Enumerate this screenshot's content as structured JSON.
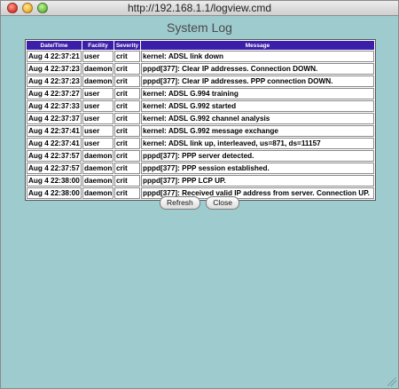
{
  "window": {
    "title": "http://192.168.1.1/logview.cmd"
  },
  "page": {
    "title": "System Log"
  },
  "table": {
    "headers": {
      "date": "Date/Time",
      "facility": "Facility",
      "severity": "Severity",
      "message": "Message"
    },
    "rows": [
      {
        "date": "Aug 4 22:37:21",
        "facility": "user",
        "severity": "crit",
        "message": "kernel: ADSL link down"
      },
      {
        "date": "Aug 4 22:37:23",
        "facility": "daemon",
        "severity": "crit",
        "message": "pppd[377]: Clear IP addresses. Connection DOWN."
      },
      {
        "date": "Aug 4 22:37:23",
        "facility": "daemon",
        "severity": "crit",
        "message": "pppd[377]: Clear IP addresses. PPP connection DOWN."
      },
      {
        "date": "Aug 4 22:37:27",
        "facility": "user",
        "severity": "crit",
        "message": "kernel: ADSL G.994 training"
      },
      {
        "date": "Aug 4 22:37:33",
        "facility": "user",
        "severity": "crit",
        "message": "kernel: ADSL G.992 started"
      },
      {
        "date": "Aug 4 22:37:37",
        "facility": "user",
        "severity": "crit",
        "message": "kernel: ADSL G.992 channel analysis"
      },
      {
        "date": "Aug 4 22:37:41",
        "facility": "user",
        "severity": "crit",
        "message": "kernel: ADSL G.992 message exchange"
      },
      {
        "date": "Aug 4 22:37:41",
        "facility": "user",
        "severity": "crit",
        "message": "kernel: ADSL link up, interleaved, us=871, ds=11157"
      },
      {
        "date": "Aug 4 22:37:57",
        "facility": "daemon",
        "severity": "crit",
        "message": "pppd[377]: PPP server detected."
      },
      {
        "date": "Aug 4 22:37:57",
        "facility": "daemon",
        "severity": "crit",
        "message": "pppd[377]: PPP session established."
      },
      {
        "date": "Aug 4 22:38:00",
        "facility": "daemon",
        "severity": "crit",
        "message": "pppd[377]: PPP LCP UP."
      },
      {
        "date": "Aug 4 22:38:00",
        "facility": "daemon",
        "severity": "crit",
        "message": "pppd[377]: Received valid IP address from server. Connection UP."
      }
    ]
  },
  "buttons": {
    "refresh": "Refresh",
    "close": "Close"
  },
  "icons": {
    "close_window": "close-window-icon",
    "minimize_window": "minimize-window-icon",
    "zoom_window": "zoom-window-icon",
    "resize_grip": "resize-grip-icon"
  },
  "colors": {
    "background": "#9ecbcd",
    "header_bg": "#3c1fa8",
    "header_text": "#ffffff"
  }
}
